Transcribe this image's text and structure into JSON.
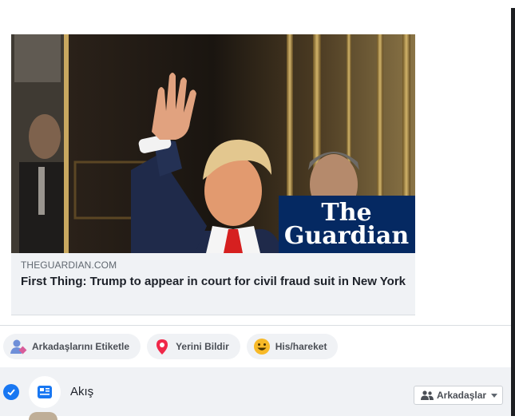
{
  "link_preview": {
    "domain": "THEGUARDIAN.COM",
    "title": "First Thing: Trump to appear in court for civil fraud suit in New York",
    "logo_line1": "The",
    "logo_line2": "Guardian"
  },
  "actions": [
    {
      "label": "Arkadaşlarını Etiketle",
      "icon": "tag-friends-icon"
    },
    {
      "label": "Yerini Bildir",
      "icon": "location-pin-icon"
    },
    {
      "label": "His/hareket",
      "icon": "smiley-icon"
    }
  ],
  "share": {
    "feed_label": "Akış",
    "audience_label": "Arkadaşlar"
  },
  "colors": {
    "brand_blue": "#1877f2",
    "guardian_blue": "#052962",
    "pin_red": "#f02849",
    "smiley_yellow": "#f7b928"
  }
}
